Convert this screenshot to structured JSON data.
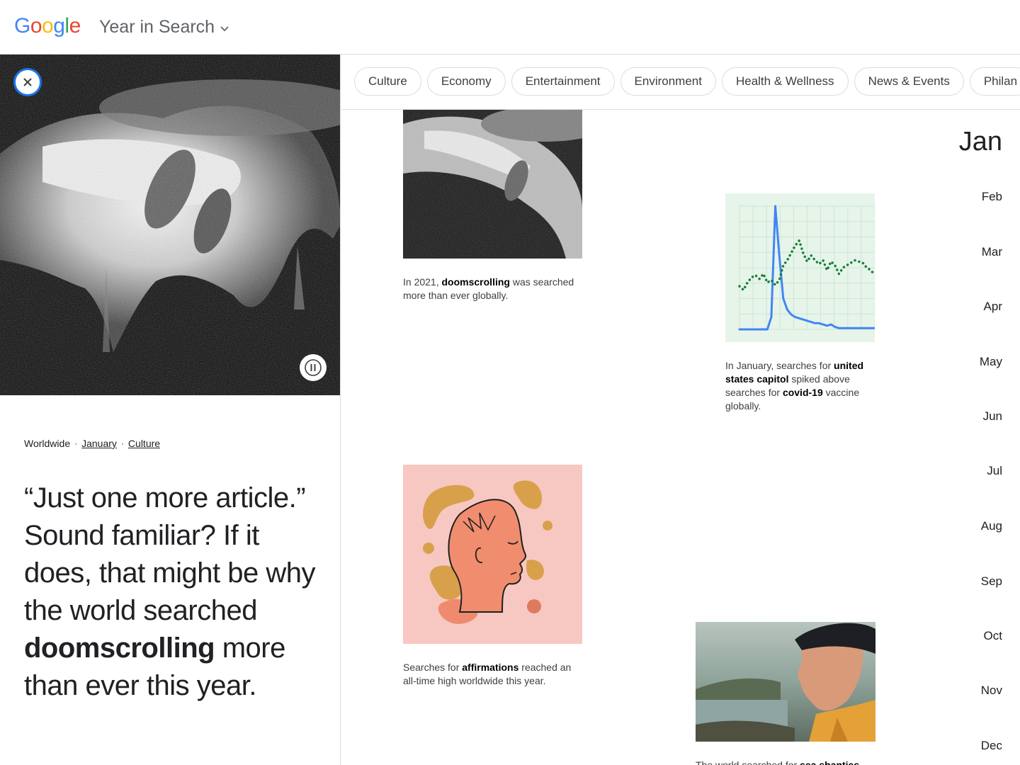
{
  "header": {
    "logo_letters": [
      {
        "ch": "G",
        "color": "#4285F4"
      },
      {
        "ch": "o",
        "color": "#EA4335"
      },
      {
        "ch": "o",
        "color": "#FBBC05"
      },
      {
        "ch": "g",
        "color": "#4285F4"
      },
      {
        "ch": "l",
        "color": "#34A853"
      },
      {
        "ch": "e",
        "color": "#EA4335"
      }
    ],
    "product_title": "Year in Search",
    "dropdown_icon": "chevron-down-icon"
  },
  "left_panel": {
    "close_icon": "close-icon",
    "pause_icon": "pause-icon",
    "breadcrumb": {
      "region": "Worldwide",
      "separator": "·",
      "month": "January",
      "category": "Culture"
    },
    "headline": {
      "part1": "“Just one more article.” Sound familiar? If it does, that might be why the world searched ",
      "bold": "doomscrolling",
      "part2": " more than ever this year."
    }
  },
  "chips": [
    "Culture",
    "Economy",
    "Entertainment",
    "Environment",
    "Health & Wellness",
    "News & Events",
    "Philan"
  ],
  "cards": {
    "doomscrolling": {
      "pre": "In 2021, ",
      "bold": "doomscrolling",
      "post": " was searched more than ever globally."
    },
    "capitol": {
      "pre": "In January, searches for ",
      "bold1": "united states capitol",
      "mid": " spiked above searches for ",
      "bold2": "covid-19",
      "post": " vaccine globally."
    },
    "affirmations": {
      "pre": "Searches for ",
      "bold": "affirmations",
      "post": " reached an all-time high worldwide this year."
    },
    "sea_shanties": {
      "pre": "The world searched for ",
      "bold": "sea shanties"
    }
  },
  "chart_data": {
    "type": "line",
    "title": "",
    "xlabel": "",
    "ylabel": "",
    "ylim": [
      0,
      100
    ],
    "series": [
      {
        "name": "",
        "color": "#4285F4",
        "style": "solid",
        "values": [
          0,
          0,
          0,
          0,
          0,
          0,
          0,
          0,
          10,
          100,
          60,
          25,
          16,
          12,
          10,
          9,
          8,
          7,
          6,
          5,
          5,
          4,
          3,
          4,
          2,
          1,
          1,
          1,
          1,
          1,
          1,
          1,
          1,
          1,
          1
        ]
      },
      {
        "name": "",
        "color": "#188038",
        "style": "dotted",
        "values": [
          35,
          32,
          38,
          42,
          44,
          41,
          45,
          38,
          40,
          36,
          40,
          52,
          56,
          62,
          68,
          72,
          62,
          55,
          60,
          56,
          53,
          56,
          48,
          55,
          52,
          45,
          50,
          52,
          54,
          56,
          55,
          54,
          50,
          48,
          44
        ]
      }
    ],
    "background": "#e6f4ea"
  },
  "months": [
    "Jan",
    "Feb",
    "Mar",
    "Apr",
    "May",
    "Jun",
    "Jul",
    "Aug",
    "Sep",
    "Oct",
    "Nov",
    "Dec"
  ],
  "active_month_index": 0
}
